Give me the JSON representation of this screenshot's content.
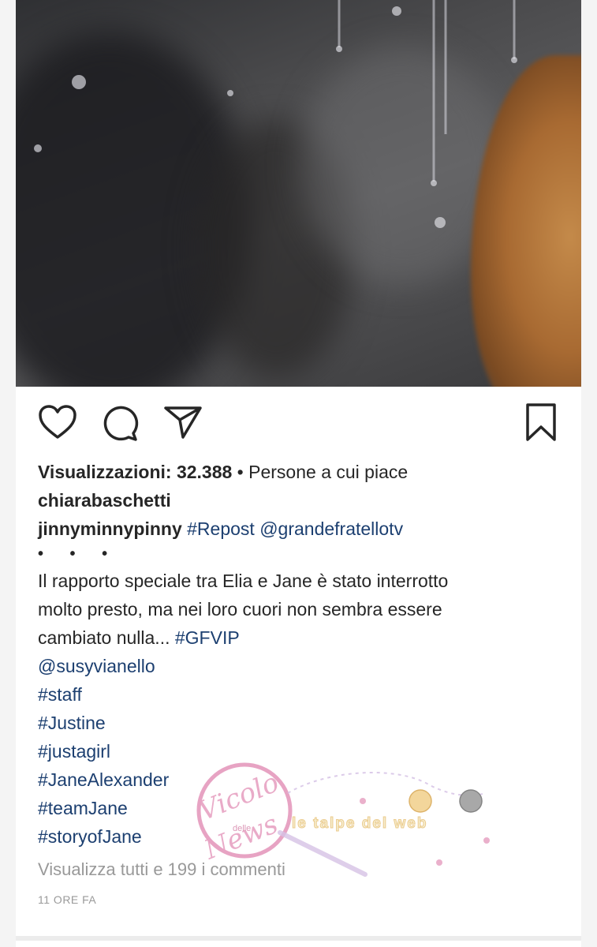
{
  "post": {
    "views_label": "Visualizzazioni: 32.388",
    "likes_label": "Persone a cui piace",
    "liked_by": "chiarabaschetti",
    "username": "jinnyminnypinny",
    "repost_tag": "#Repost",
    "repost_mention": "@grandefratellotv",
    "more_dots": "• • •",
    "caption_lines": [
      "Il rapporto speciale tra Elia e Jane è stato interrotto",
      "molto presto, ma nei loro cuori non sembra essere",
      "cambiato nulla..."
    ],
    "caption_tag": "#GFVIP",
    "hashtags": [
      "@susyvianello",
      "#staff",
      "#Justine",
      "#justagirl",
      "#JaneAlexander",
      "#teamJane",
      "#storyofJane"
    ],
    "view_comments": "Visualizza tutti e 199 i commenti",
    "timestamp": "11 ORE FA"
  },
  "icons": [
    "heart-icon",
    "comment-icon",
    "send-icon",
    "bookmark-icon"
  ],
  "watermark": {
    "brand": "Vicolo delle News",
    "secondary": "le talpe del web"
  },
  "colors": {
    "hashtag": "#1c3f70",
    "muted": "#999999",
    "text": "#262626",
    "watermark_pink": "#e7a3c3",
    "watermark_gold": "#e8c27a"
  }
}
